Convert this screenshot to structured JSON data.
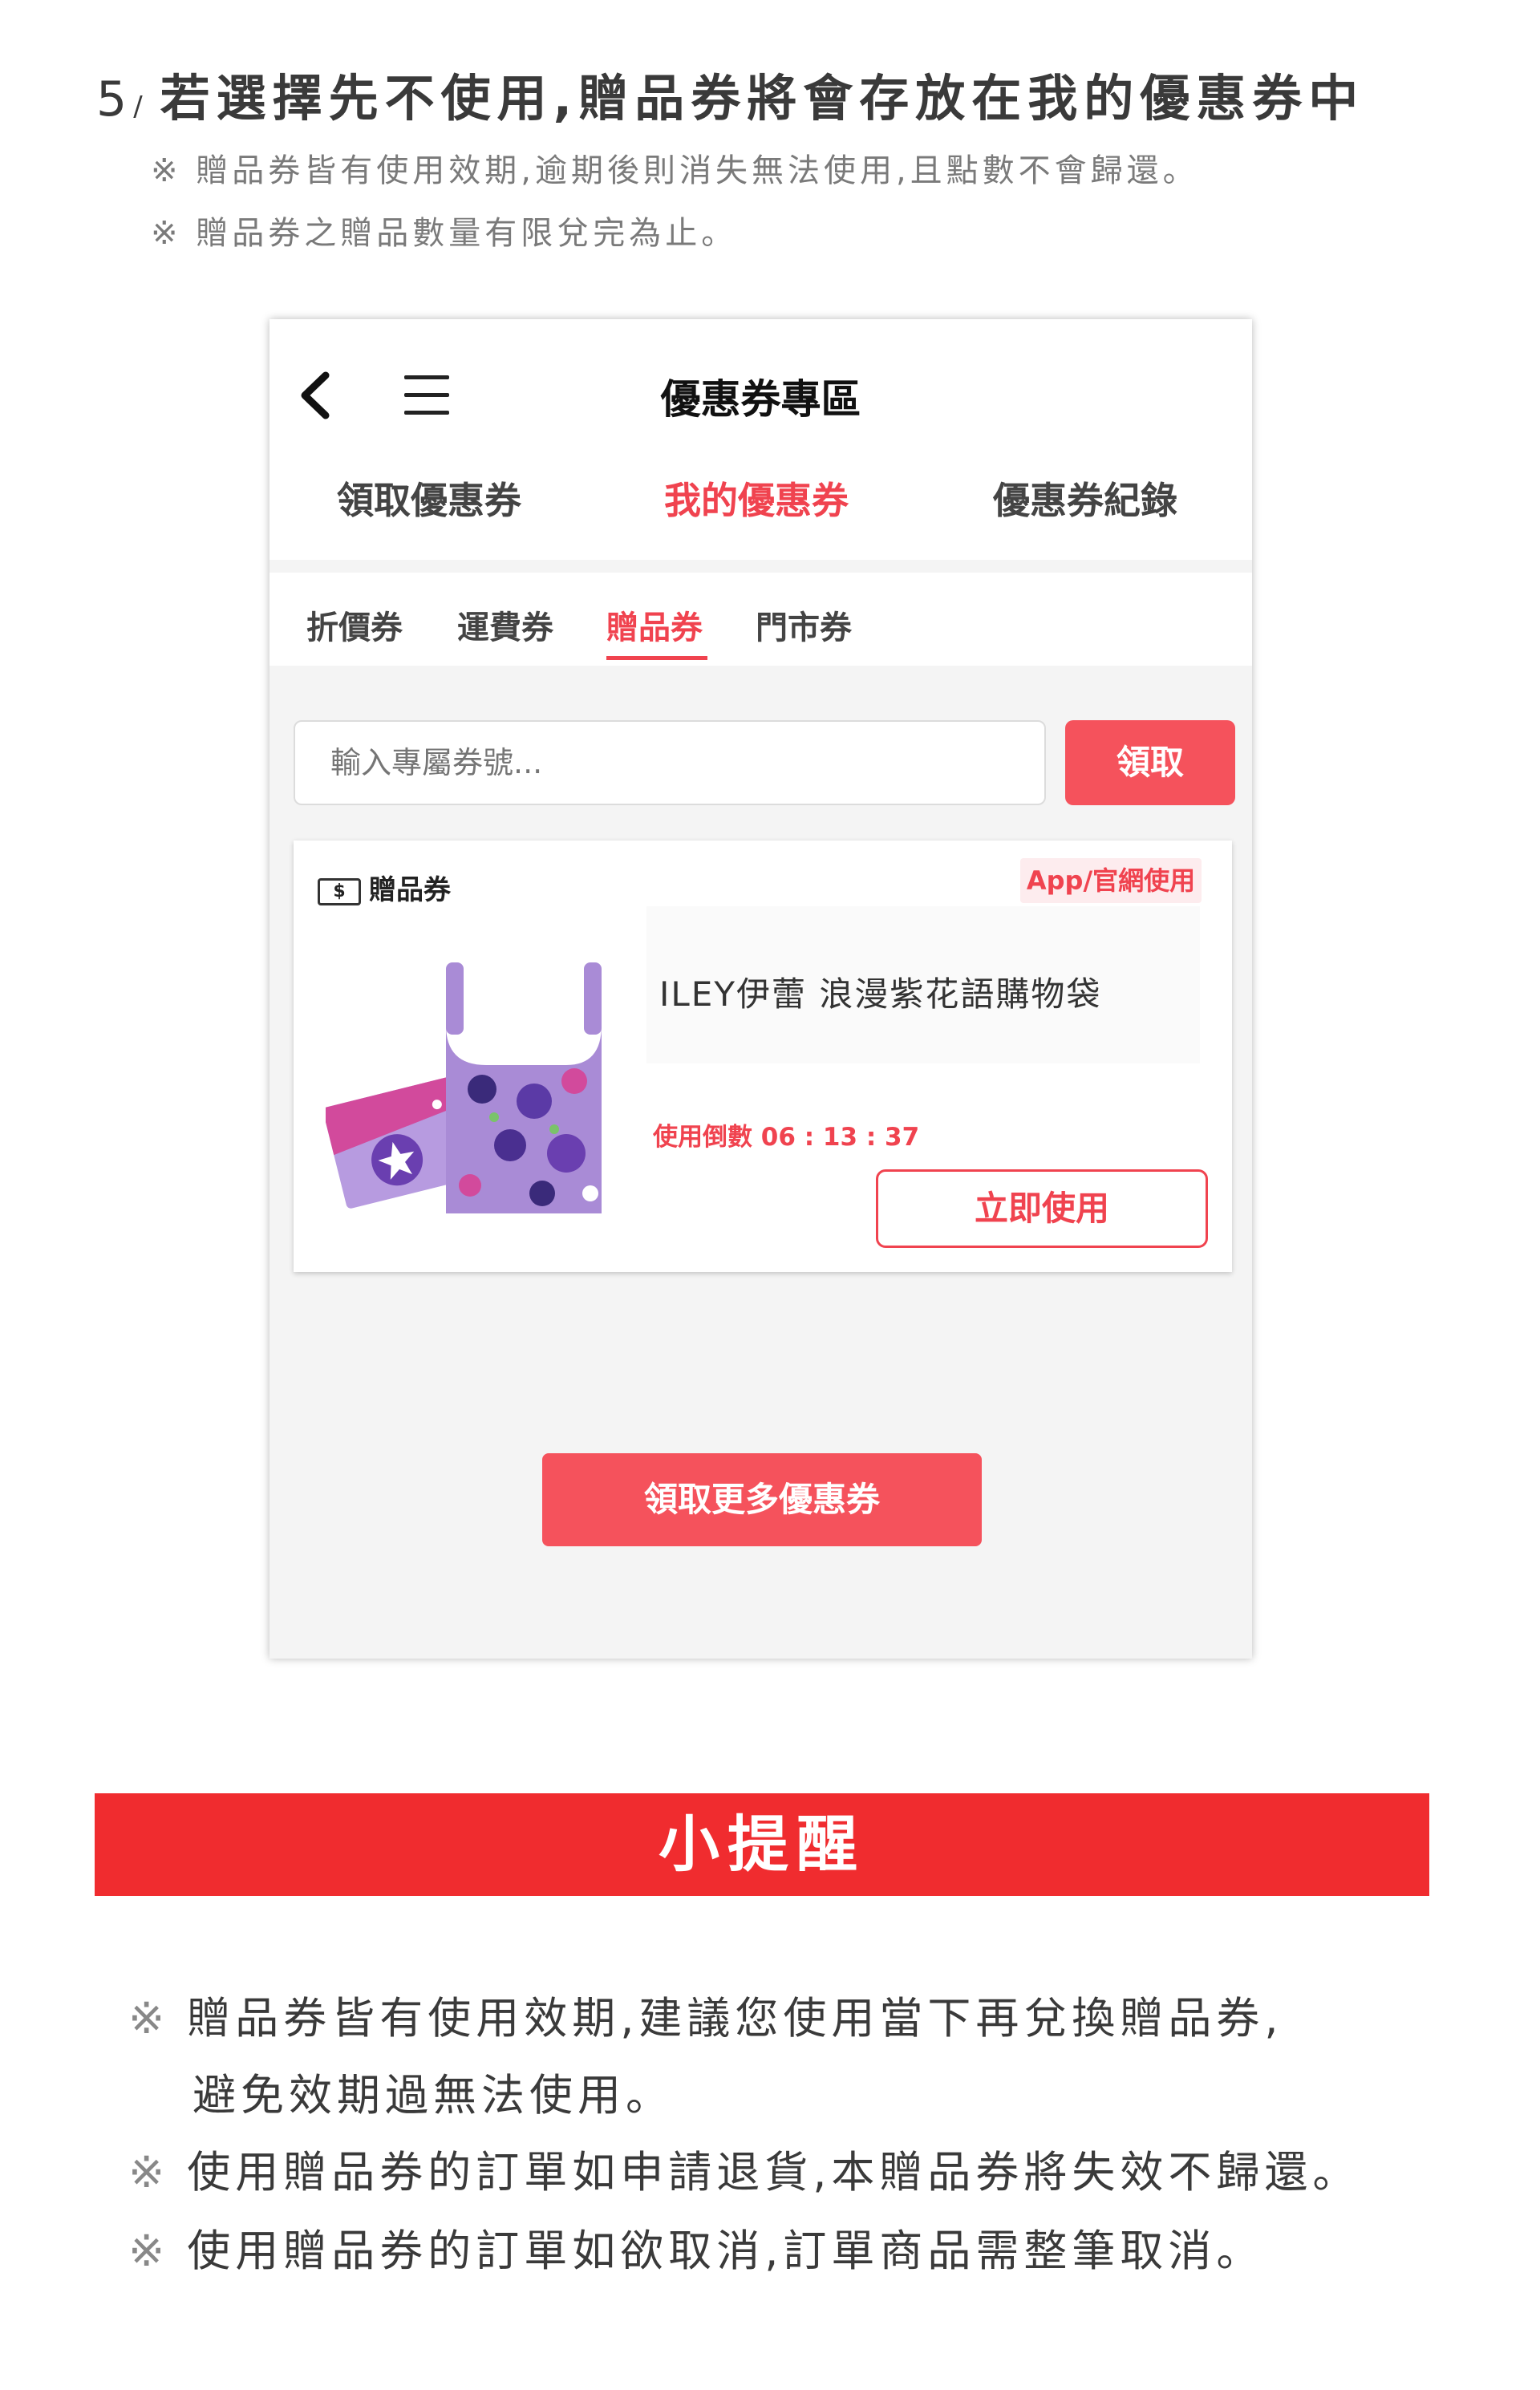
{
  "step": {
    "number": "5",
    "slash": "/",
    "title": "若選擇先不使用,贈品券將會存放在我的優惠券中",
    "notes": [
      "※ 贈品券皆有使用效期,逾期後則消失無法使用,且點數不會歸還。",
      "※ 贈品券之贈品數量有限兌完為止。"
    ]
  },
  "app": {
    "header": {
      "title": "優惠券專區",
      "back_icon": "chevron-left-icon",
      "menu_icon": "hamburger-menu-icon"
    },
    "tabs": [
      {
        "label": "領取優惠券",
        "active": false
      },
      {
        "label": "我的優惠券",
        "active": true
      },
      {
        "label": "優惠券紀錄",
        "active": false
      }
    ],
    "subtabs": [
      {
        "label": "折價券",
        "active": false
      },
      {
        "label": "運費券",
        "active": false
      },
      {
        "label": "贈品券",
        "active": true
      },
      {
        "label": "門市券",
        "active": false
      }
    ],
    "code_input": {
      "placeholder": "輸入專屬券號..."
    },
    "claim_button": "領取",
    "coupon": {
      "type_icon": "$",
      "type_label": "贈品券",
      "badge": "App/官網使用",
      "product_name": "ILEY伊蕾 浪漫紫花語購物袋",
      "countdown": "使用倒數 06 : 13 : 37",
      "use_button": "立即使用"
    },
    "more_button": "領取更多優惠券"
  },
  "reminder": {
    "title": "小提醒",
    "mark": "※",
    "items": [
      "贈品券皆有使用效期,建議您使用當下再兌換贈品券,",
      "避免效期過無法使用。",
      "使用贈品券的訂單如申請退貨,本贈品券將失效不歸還。",
      "使用贈品券的訂單如欲取消,訂單商品需整筆取消。"
    ]
  },
  "colors": {
    "accent": "#f0434f",
    "button": "#f5525c",
    "banner": "#f02c2f",
    "phone_bg": "#f4f4f4",
    "product_purple": "#a98bd6"
  }
}
